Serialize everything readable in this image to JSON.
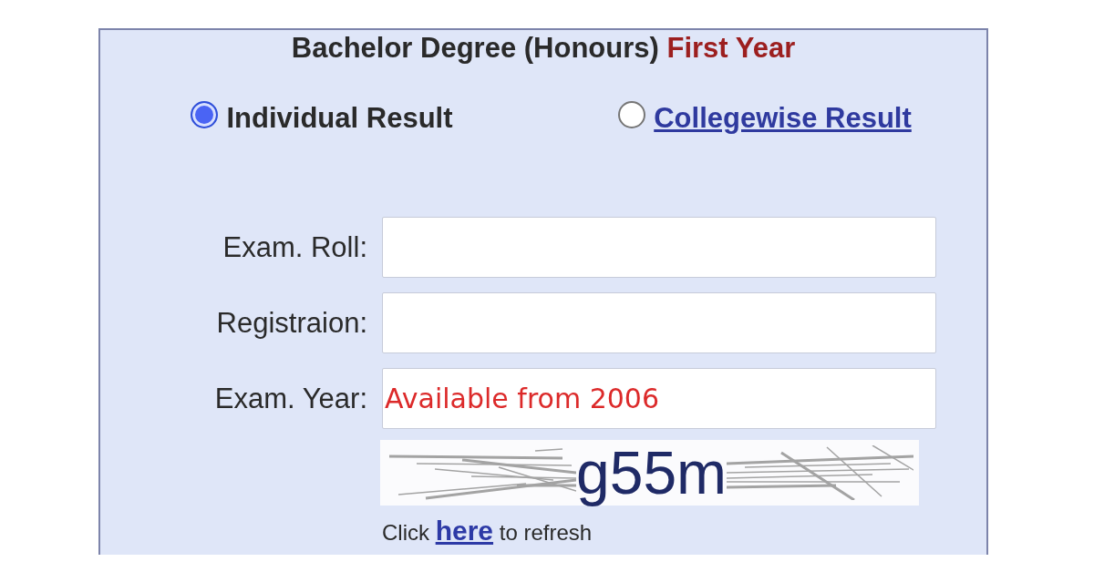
{
  "form": {
    "title": {
      "text": "Bachelor Degree (Honours)",
      "highlight": "First Year"
    },
    "result_types": [
      {
        "kind": "text",
        "label": "Individual Result",
        "selected": true
      },
      {
        "kind": "link",
        "label": "Collegewise Result",
        "selected": false
      }
    ],
    "fields": [
      {
        "label": "Exam. Roll:"
      },
      {
        "label": "Registraion:"
      },
      {
        "label": "Exam. Year:",
        "placeholder": "Available from 2006"
      }
    ],
    "captcha": {
      "text": "g55m"
    },
    "refresh": {
      "before": "Click",
      "link": "here",
      "after": "to refresh"
    }
  }
}
